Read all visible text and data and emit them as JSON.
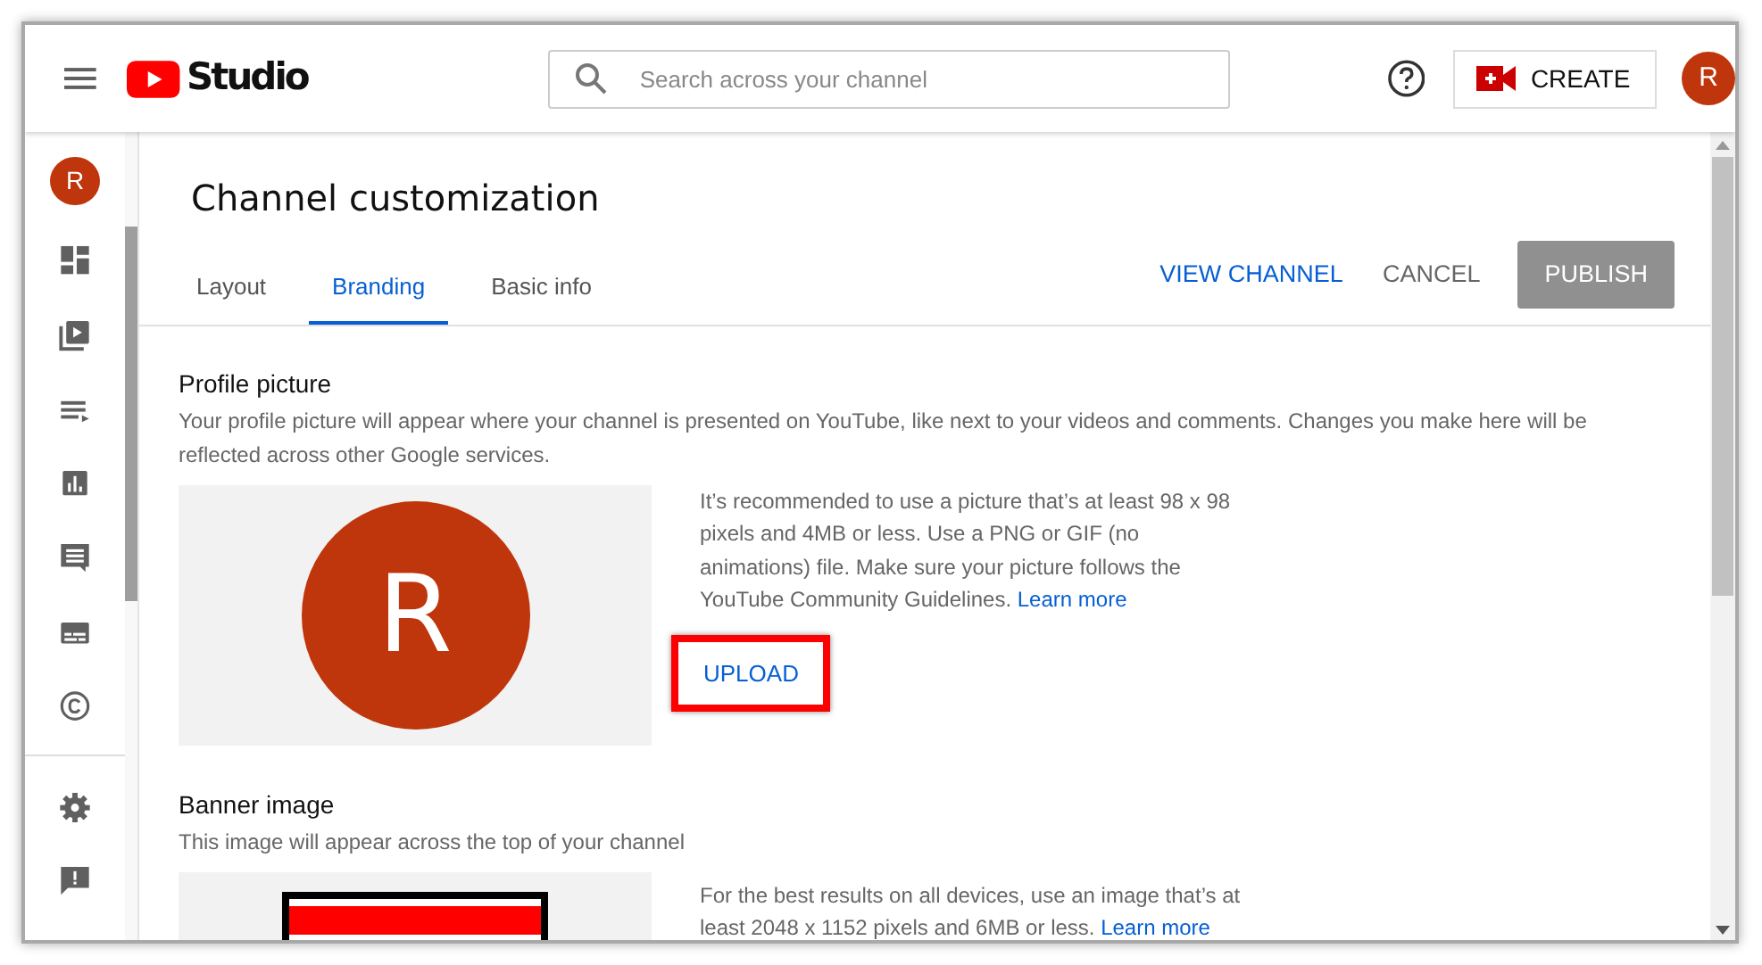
{
  "header": {
    "logo_text": "Studio",
    "search": {
      "placeholder": "Search across your channel"
    },
    "create_button": "CREATE",
    "avatar": "R"
  },
  "sidebar": {
    "avatar": "R"
  },
  "page": {
    "title": "Channel customization",
    "tabs": [
      {
        "label": "Layout",
        "selected": false
      },
      {
        "label": "Branding",
        "selected": true
      },
      {
        "label": "Basic info",
        "selected": false
      }
    ],
    "actions": [
      {
        "label": "VIEW CHANNEL",
        "kind": "link",
        "disabled": false
      },
      {
        "label": "CANCEL",
        "kind": "text",
        "disabled": false
      },
      {
        "label": "PUBLISH",
        "kind": "primary",
        "disabled": true
      }
    ]
  },
  "sections": [
    {
      "kind": "profile",
      "title": "Profile picture",
      "description": "Your profile picture will appear where your channel is presented on YouTube, like next to your videos and comments. Changes you make here will be reflected across other Google services.",
      "avatar": "R",
      "info": "It’s recommended to use a picture that’s at least 98 x 98 pixels and 4MB or less. Use a PNG or GIF (no animations) file. Make sure your picture follows the YouTube Community Guidelines.",
      "link": "Learn more",
      "button": {
        "label": "UPLOAD",
        "highlighted": true
      }
    },
    {
      "kind": "banner",
      "title": "Banner image",
      "description": "This image will appear across the top of your channel",
      "info": "For the best results on all devices, use an image that’s at least 2048 x 1152 pixels and 6MB or less.",
      "link": "Learn more"
    }
  ]
}
